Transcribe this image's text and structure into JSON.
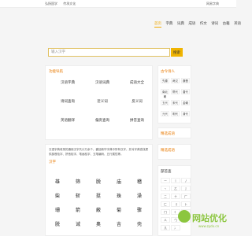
{
  "topbar": {
    "links": [
      "弘扬国学",
      "传承文化"
    ],
    "right": "网易字典"
  },
  "logo": "",
  "nav": [
    "首页",
    "字典",
    "词典",
    "成语",
    "作文",
    "诗词",
    "古籍",
    "英语"
  ],
  "search": {
    "placeholder": "输入汉字",
    "button": "搜索"
  },
  "tools_title": "功能导航",
  "tools": [
    {
      "t": "汉语字典",
      "s": ""
    },
    {
      "t": "汉语词典",
      "s": ""
    },
    {
      "t": "成语大全",
      "s": ""
    },
    {
      "t": "诗词查询",
      "s": ""
    },
    {
      "t": "近义词",
      "s": ""
    },
    {
      "t": "反义词",
      "s": ""
    },
    {
      "t": "英语翻译",
      "s": ""
    },
    {
      "t": "偏旁查询",
      "s": ""
    },
    {
      "t": "拼音查询",
      "s": ""
    }
  ],
  "poets_title": "古今诗人",
  "poets": [
    "先秦",
    "两汉",
    "魏晋",
    "南北朝",
    "隋代",
    "唐代",
    "五代",
    "宋代",
    "金朝",
    "元代",
    "明代",
    "清代"
  ],
  "side2_title": "精选成语",
  "intro": "汉语字典收录的通用汉字共计万余个，囊括新华字典中所有汉字，并对字典查找提供部首检字、拼音检字、笔画检字、五笔编码、五行属性等。",
  "grid_title": "汉字",
  "chars": [
    {
      "py": "",
      "hz": "雄"
    },
    {
      "py": "",
      "hz": "筛"
    },
    {
      "py": "",
      "hz": "脱"
    },
    {
      "py": "",
      "hz": "庙"
    },
    {
      "py": "",
      "hz": "稽"
    },
    {
      "py": "",
      "hz": "柴"
    },
    {
      "py": "",
      "hz": "斩"
    },
    {
      "py": "",
      "hz": "挺"
    },
    {
      "py": "",
      "hz": "珠"
    },
    {
      "py": "",
      "hz": "澡"
    },
    {
      "py": "",
      "hz": "珊"
    },
    {
      "py": "",
      "hz": "箭"
    },
    {
      "py": "",
      "hz": "蔽"
    },
    {
      "py": "",
      "hz": "菊"
    },
    {
      "py": "",
      "hz": "骤"
    },
    {
      "py": "",
      "hz": "脱"
    },
    {
      "py": "",
      "hz": "诫"
    },
    {
      "py": "",
      "hz": "奥"
    },
    {
      "py": "",
      "hz": "吉"
    },
    {
      "py": "",
      "hz": "壳"
    }
  ],
  "side3_title": "精选成语",
  "side4_title": "精选成语",
  "radicals_title": "部首查",
  "radicals": [
    "一",
    "丨",
    "丿",
    "丶",
    "乙",
    "亅",
    "二",
    "十",
    "厂",
    "匚",
    "刂",
    "卜",
    "冂",
    "亻",
    "八",
    "人",
    "勹",
    "儿",
    "几",
    "冫"
  ],
  "brand": {
    "text": "网站优化",
    "url": "www.zydx.cn"
  }
}
